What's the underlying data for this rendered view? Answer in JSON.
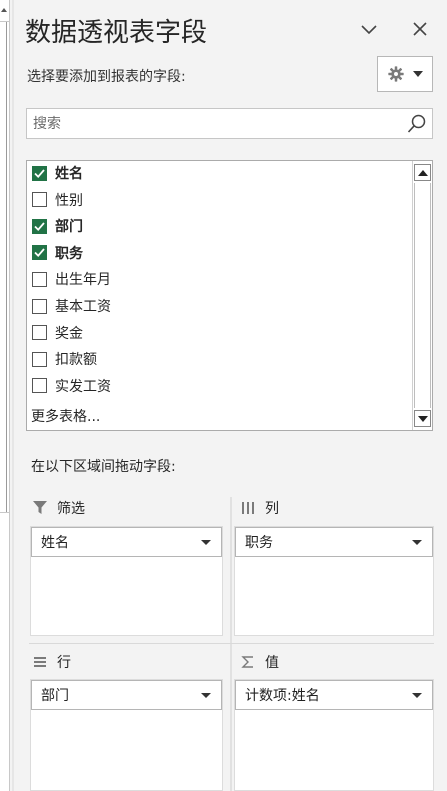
{
  "panel": {
    "title": "数据透视表字段",
    "subtitle": "选择要添加到报表的字段:",
    "collapse_icon": "chevron-down-icon",
    "close_icon": "close-icon",
    "tools_icon": "gear-icon"
  },
  "search": {
    "placeholder": "搜索"
  },
  "fields": [
    {
      "label": "姓名",
      "checked": true
    },
    {
      "label": "性别",
      "checked": false
    },
    {
      "label": "部门",
      "checked": true
    },
    {
      "label": "职务",
      "checked": true
    },
    {
      "label": "出生年月",
      "checked": false
    },
    {
      "label": "基本工资",
      "checked": false
    },
    {
      "label": "奖金",
      "checked": false
    },
    {
      "label": "扣款额",
      "checked": false
    },
    {
      "label": "实发工资",
      "checked": false
    }
  ],
  "more_tables": "更多表格...",
  "drag_hint": "在以下区域间拖动字段:",
  "areas": {
    "filter": {
      "label": "筛选",
      "icon": "filter-icon",
      "items": [
        "姓名"
      ]
    },
    "columns": {
      "label": "列",
      "icon": "columns-icon",
      "items": [
        "职务"
      ]
    },
    "rows": {
      "label": "行",
      "icon": "rows-icon",
      "items": [
        "部门"
      ]
    },
    "values": {
      "label": "值",
      "icon": "sigma-icon",
      "items": [
        "计数项:姓名"
      ]
    }
  },
  "colors": {
    "checkbox_checked": "#217346",
    "panel_bg": "#f3f3f3"
  }
}
